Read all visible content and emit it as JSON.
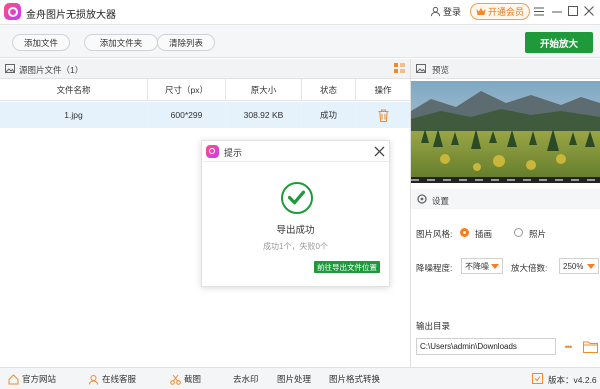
{
  "window": {
    "title": "金舟图片无损放大器",
    "login_label": "登录",
    "vip_label": "开通会员",
    "controls": [
      "menu",
      "minimize",
      "maximize",
      "close"
    ]
  },
  "toolbar": {
    "add_file": "添加文件",
    "add_folder": "添加文件夹",
    "clear_list": "清除列表",
    "start": "开始放大"
  },
  "source": {
    "title": "源图片文件（1）",
    "columns": [
      "文件名称",
      "尺寸（px）",
      "原大小",
      "状态",
      "操作"
    ],
    "rows": [
      {
        "name": "1.jpg",
        "size_px": "600*299",
        "orig_size": "308.92 KB",
        "status": "成功"
      }
    ]
  },
  "dialog": {
    "title": "提示",
    "message": "导出成功",
    "summary": "成功1个，失败0个",
    "goto_button": "前往导出文件位置"
  },
  "preview": {
    "title": "预览"
  },
  "settings": {
    "title": "设置",
    "style_label": "图片风格:",
    "style_options": [
      "插画",
      "照片"
    ],
    "style_selected": "插画",
    "denoise_label": "降噪程度:",
    "denoise_value": "不降噪",
    "scale_label": "放大倍数:",
    "scale_value": "250%",
    "output_label": "输出目录",
    "output_path": "C:\\Users\\admin\\Downloads",
    "browse_label": "•••"
  },
  "statusbar": {
    "items": [
      "官方网站",
      "在线客服",
      "截图",
      "去水印",
      "图片处理",
      "图片格式转换"
    ],
    "version": "版本：v4.2.6"
  },
  "colors": {
    "accent_green": "#1f9a3a",
    "accent_orange": "#ff7a1a",
    "row_highlight": "#e5f1fb"
  }
}
